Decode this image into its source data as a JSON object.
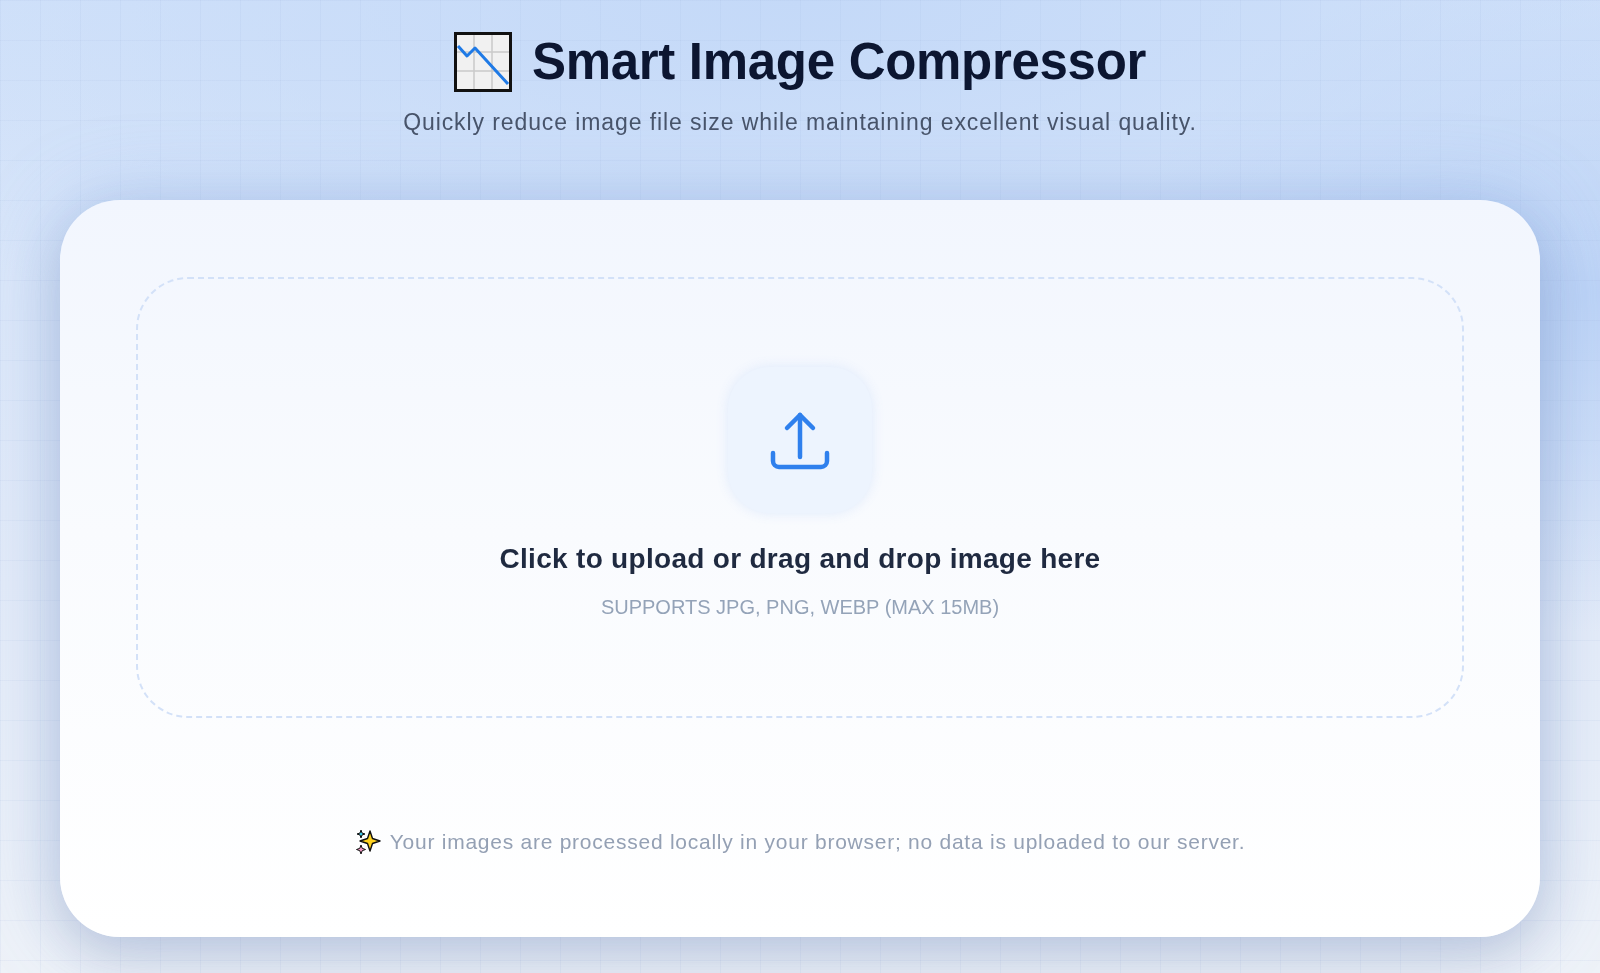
{
  "header": {
    "title": "Smart Image Compressor",
    "subtitle": "Quickly reduce image file size while maintaining excellent visual quality."
  },
  "dropzone": {
    "prompt": "Click to upload or drag and drop image here",
    "formats": "SUPPORTS JPG, PNG, WEBP (MAX 15MB)"
  },
  "privacy_note": "Your images are processed locally in your browser; no data is uploaded to our server."
}
